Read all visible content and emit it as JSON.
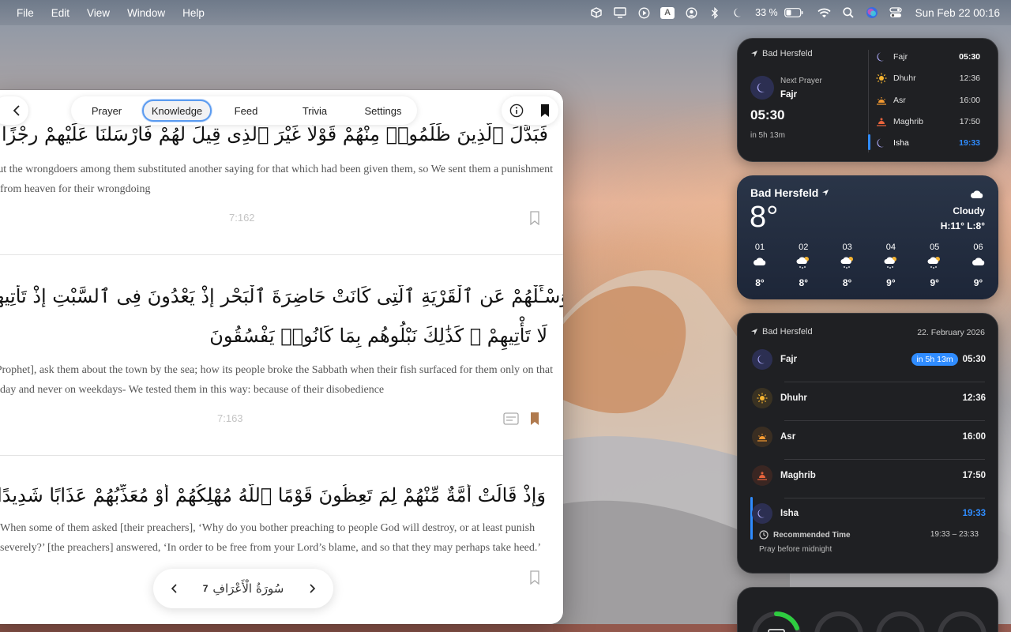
{
  "menubar": {
    "apple_menu": [
      "File",
      "Edit",
      "View",
      "Window",
      "Help"
    ],
    "input_source": "A",
    "battery": "33 %",
    "datetime": "Sun Feb 22  00:16"
  },
  "app": {
    "tabs": [
      "Prayer",
      "Knowledge",
      "Feed",
      "Trivia",
      "Settings"
    ],
    "selected_tab": "Knowledge",
    "verses": [
      {
        "arabic": "فَبَدَّلَ ٱلَّذِينَ ظَلَمُوا۟ مِنْهُمْ قَوْلًا غَيْرَ ٱلَّذِى قِيلَ لَهُمْ فَأَرْسَلْنَا عَلَيْهِمْ رِجْزًا مِّنَ ٱلسَّمَآءِ بِمَا كَانُوا۟ يَظْلِمُونَ",
        "translation_1": "But the wrongdoers among them substituted another saying for that which had been given them, so We sent them a punishment",
        "translation_2": "from heaven for their wrongdoing",
        "ref": "7:162",
        "bookmarked": false
      },
      {
        "arabic_1": "وَسْـَٔلْهُمْ عَنِ ٱلْقَرْيَةِ ٱلَّتِى كَانَتْ حَاضِرَةَ ٱلْبَحْرِ إِذْ يَعْدُونَ فِى ٱلسَّبْتِ إِذْ تَأْتِيهِمْ حِيتَانُهُمْ يَوْمَ سَبْتِهِمْ شُرَّعًا وَيَوْمَ لَا يَسْبِتُونَ",
        "arabic_2": "لَا تَأْتِيهِمْ ۚ كَذَٰلِكَ نَبْلُوهُم بِمَا كَانُوا۟ يَفْسُقُونَ",
        "translation_1": "[Prophet], ask them about the town by the sea; how its people broke the Sabbath when their fish surfaced for them only on that",
        "translation_2": "day and never on weekdays- We tested them in this way: because of their disobedience",
        "ref": "7:163",
        "bookmarked": true
      },
      {
        "arabic": "وَإِذْ قَالَتْ أُمَّةٌ مِّنْهُمْ لِمَ تَعِظُونَ قَوْمًا ٱللَّهُ مُهْلِكُهُمْ أَوْ مُعَذِّبُهُمْ عَذَابًا شَدِيدًا قَالُوا۟ مَعْذِرَةً إِلَىٰ رَبِّكُمْ وَلَعَلَّهُمْ يَتَّقُونَ",
        "translation_1": "When some of them asked [their preachers], ‘Why do you bother preaching to people God will destroy, or at least punish",
        "translation_2": "severely?’ [the preachers] answered, ‘In order to be free from your Lord’s blame, and so that they may perhaps take heed.’",
        "bookmarked": false
      }
    ],
    "surah": {
      "name": "سُورَةُ الْأَعْرَافِ",
      "number": "7"
    }
  },
  "prayer_widget_small": {
    "location": "Bad Hersfeld",
    "next_label": "Next Prayer",
    "next_name": "Fajr",
    "next_time": "05:30",
    "countdown": "in 5h 13m",
    "prayers": [
      {
        "name": "Fajr",
        "time": "05:30",
        "icon": "moon-icon"
      },
      {
        "name": "Dhuhr",
        "time": "12:36",
        "icon": "sun-icon"
      },
      {
        "name": "Asr",
        "time": "16:00",
        "icon": "sunset-icon"
      },
      {
        "name": "Maghrib",
        "time": "17:50",
        "icon": "sundown-icon"
      },
      {
        "name": "Isha",
        "time": "19:33",
        "icon": "moon-icon",
        "current": true
      }
    ]
  },
  "weather_widget": {
    "location": "Bad Hersfeld",
    "temp": "8°",
    "condition": "Cloudy",
    "hilo": "H:11° L:8°",
    "hours": [
      {
        "h": "01",
        "t": "8°",
        "icon": "cloud-icon"
      },
      {
        "h": "02",
        "t": "8°",
        "icon": "snow-sun-icon"
      },
      {
        "h": "03",
        "t": "8°",
        "icon": "snow-sun-icon"
      },
      {
        "h": "04",
        "t": "9°",
        "icon": "snow-sun-icon"
      },
      {
        "h": "05",
        "t": "9°",
        "icon": "snow-sun-icon"
      },
      {
        "h": "06",
        "t": "9°",
        "icon": "cloud-icon"
      }
    ]
  },
  "prayer_widget_large": {
    "location": "Bad Hersfeld",
    "date": "22. February 2026",
    "badge": "in 5h 13m",
    "prayers": [
      {
        "name": "Fajr",
        "time": "05:30"
      },
      {
        "name": "Dhuhr",
        "time": "12:36"
      },
      {
        "name": "Asr",
        "time": "16:00"
      },
      {
        "name": "Maghrib",
        "time": "17:50"
      },
      {
        "name": "Isha",
        "time": "19:33"
      }
    ],
    "recommended_label": "Recommended Time",
    "recommended_range": "19:33 – 23:33",
    "note": "Pray before midnight"
  },
  "colors": {
    "accent_blue": "#2f8cff",
    "bookmark_brown": "#b07a4e",
    "selected_tab_ring": "#5b9bf0",
    "battery_ring": "#2ecc40"
  }
}
